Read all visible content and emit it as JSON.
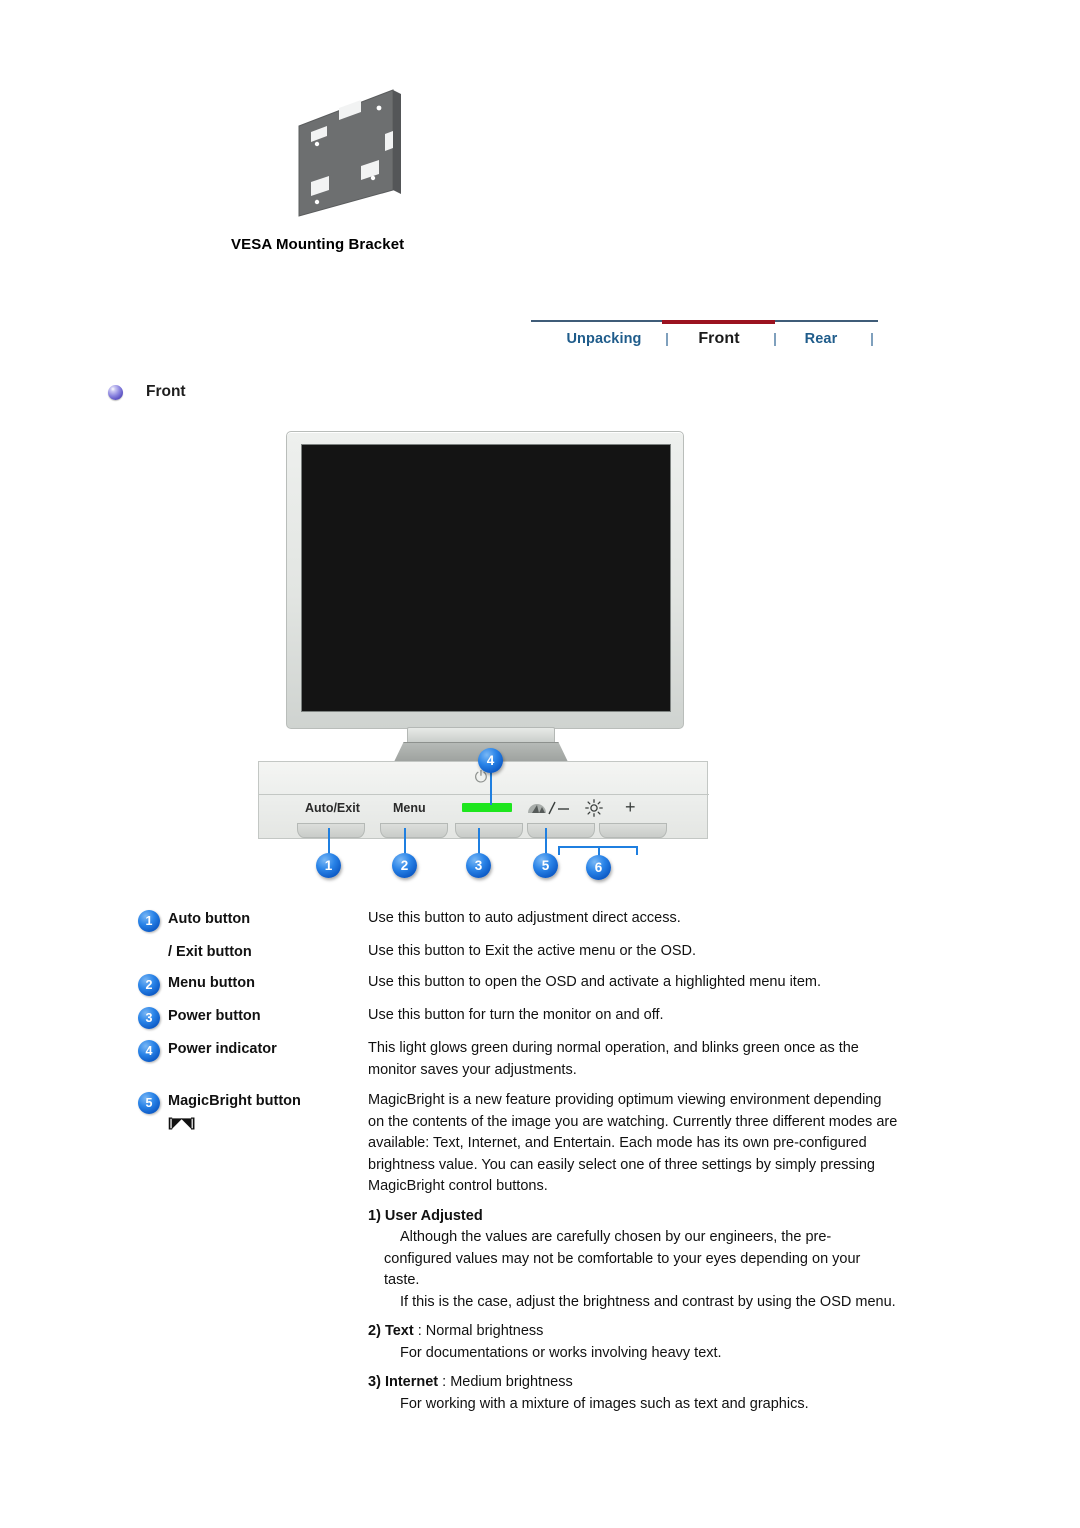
{
  "vesa": {
    "caption": "VESA Mounting Bracket",
    "image_name": "vesa-mounting-bracket-illustration"
  },
  "tabs": {
    "items": [
      {
        "label": "Unpacking",
        "active": false
      },
      {
        "label": "Front",
        "active": true
      },
      {
        "label": "Rear",
        "active": false
      }
    ],
    "separator": "|",
    "active_color": "#9b1220",
    "link_color": "#1f5c8b",
    "rule_color": "#3f5c78"
  },
  "section": {
    "heading": "Front",
    "bullet_icon": "sphere-bullet-icon"
  },
  "monitor": {
    "image_name": "monitor-front-view-illustration",
    "control_panel": {
      "power_symbol": "⏻",
      "labels": [
        {
          "text": "Auto/Exit"
        },
        {
          "text": "Menu"
        }
      ],
      "led_color": "#1ee61e",
      "magicbright_icon": "magicbright-icon",
      "minus_label": "/ —",
      "brightness_icon": "sun-brightness-icon",
      "plus_label": "+"
    },
    "callouts": [
      "1",
      "2",
      "3",
      "4",
      "5",
      "6"
    ]
  },
  "descriptions": [
    {
      "number": "1",
      "term": "Auto button",
      "definition": "Use this button to auto adjustment direct access."
    },
    {
      "number": "",
      "term": "/ Exit button",
      "definition": "Use this button to Exit the active menu or the OSD."
    },
    {
      "number": "2",
      "term": "Menu button",
      "definition": "Use this button to open the OSD and activate a highlighted menu item."
    },
    {
      "number": "3",
      "term": "Power button",
      "definition": "Use this button for turn the monitor on and off."
    },
    {
      "number": "4",
      "term": "Power indicator",
      "definition": "This light glows green during normal operation, and blinks green once as the monitor saves your adjustments."
    },
    {
      "number": "5",
      "term": "MagicBright button",
      "term_glyph": "[◤◥]",
      "definition": "MagicBright is a new feature providing optimum viewing environment depending on the contents of the image you are watching. Currently three different modes are available: Text, Internet, and Entertain. Each mode has its own pre-configured brightness value. You can easily select one of three settings by simply pressing MagicBright control buttons."
    }
  ],
  "magicbright_modes": {
    "user_adjusted": {
      "heading": "1) User Adjusted",
      "para1": "Although the values are carefully chosen by our engineers, the pre-configured values may not be comfortable to your eyes depending on your taste.",
      "para2": "If this is the case, adjust the brightness and contrast by using the OSD menu."
    },
    "text": {
      "number": "2)",
      "name": "Text",
      "level": ": Normal brightness",
      "detail": "For documentations or works involving heavy text."
    },
    "internet": {
      "number": "3)",
      "name": "Internet",
      "level": ": Medium brightness",
      "detail": "For working with a mixture of images such as text and graphics."
    }
  }
}
